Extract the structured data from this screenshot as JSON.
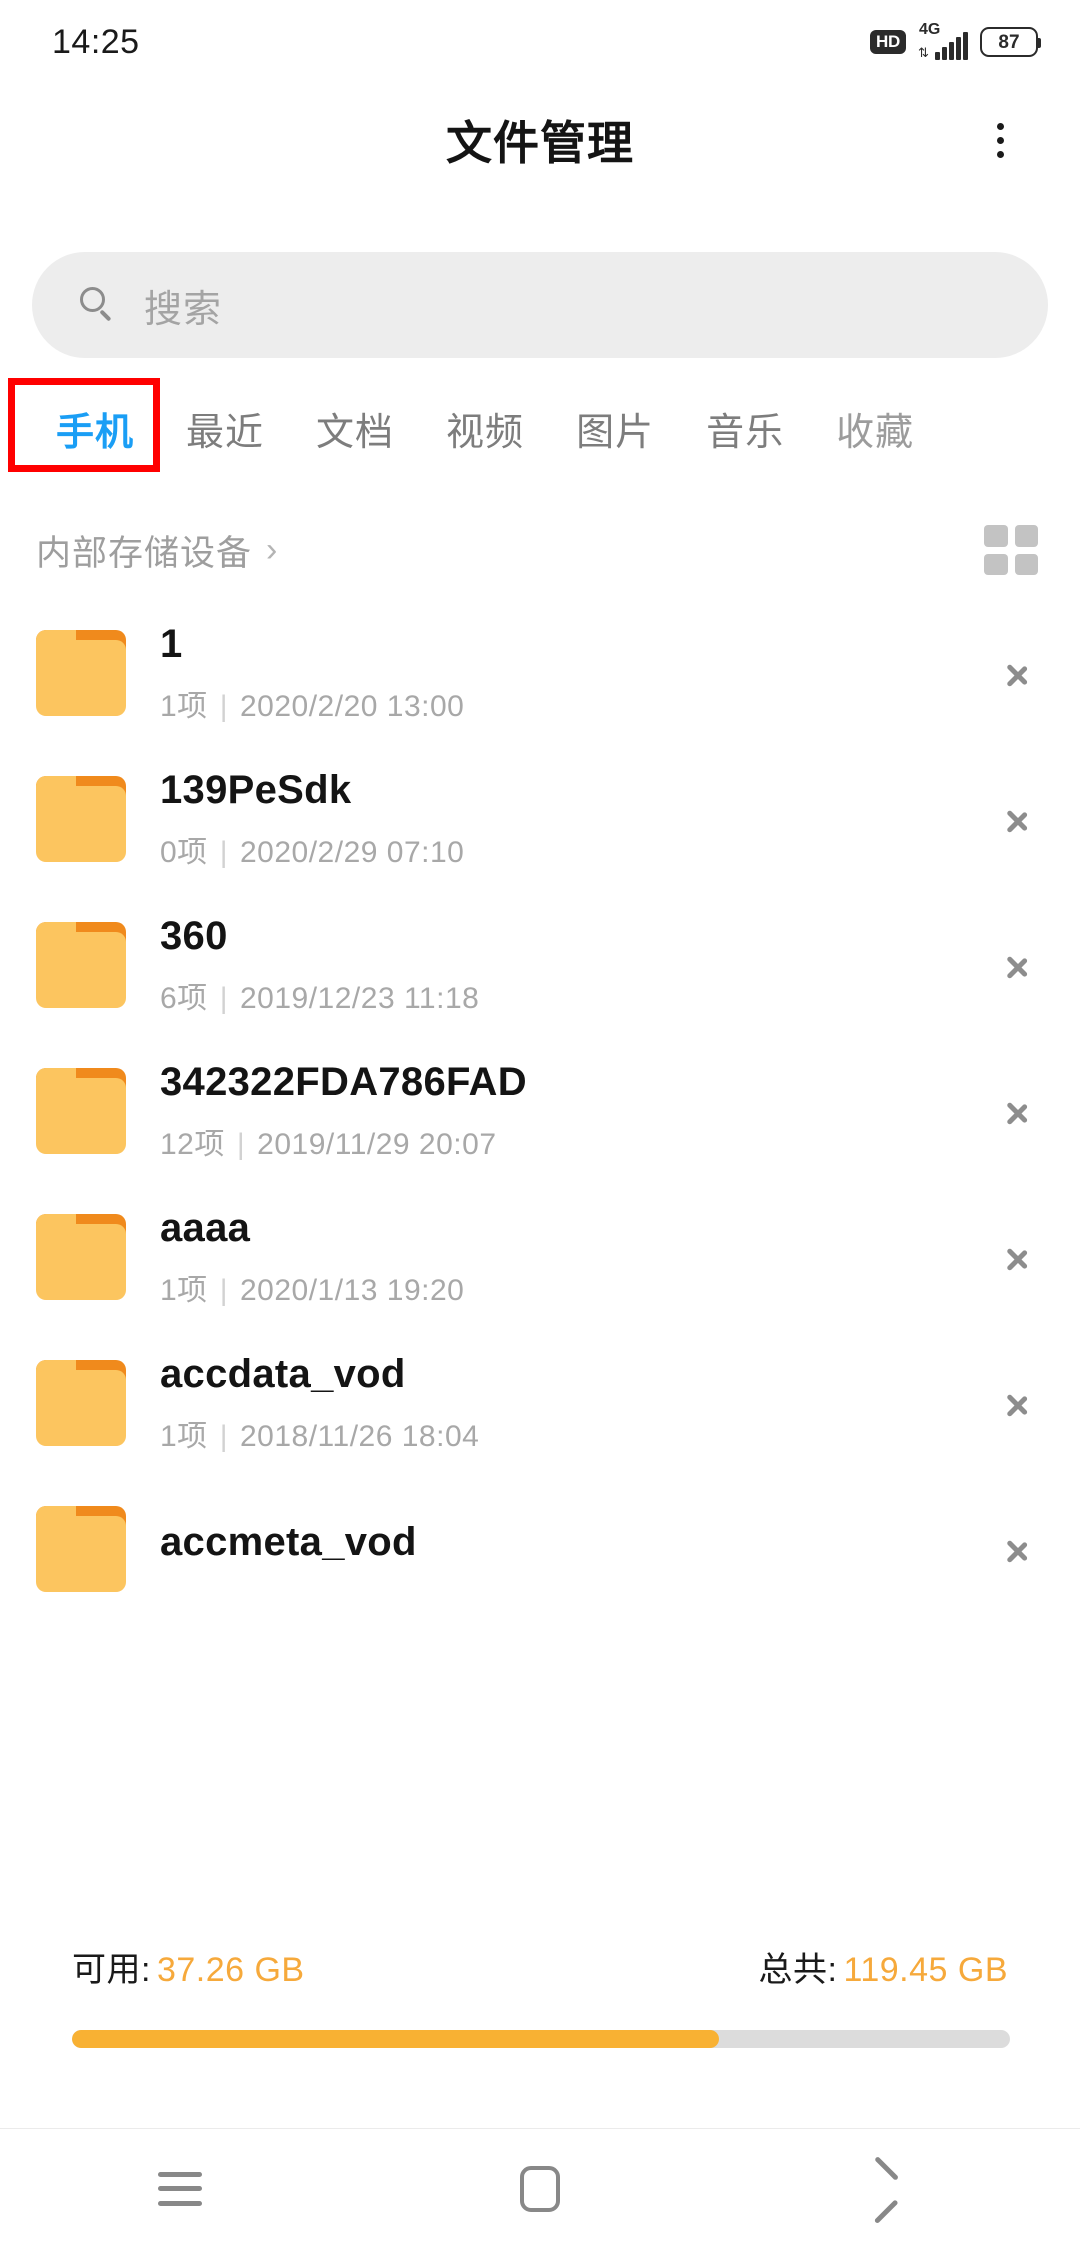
{
  "status_bar": {
    "time": "14:25",
    "hd_badge": "HD",
    "network": "4G",
    "battery_level": "87"
  },
  "app_bar": {
    "title": "文件管理",
    "overflow_menu_name": "more-options"
  },
  "search": {
    "placeholder": "搜索",
    "value": ""
  },
  "tabs": {
    "active_index": 0,
    "items": [
      {
        "label": "手机"
      },
      {
        "label": "最近"
      },
      {
        "label": "文档"
      },
      {
        "label": "视频"
      },
      {
        "label": "图片"
      },
      {
        "label": "音乐"
      },
      {
        "label": "收藏"
      }
    ],
    "highlight_color": "#ff0000",
    "active_color": "#1a9ef5"
  },
  "breadcrumb": {
    "path": "内部存储设备",
    "separator": "›",
    "view_toggle_name": "grid-view"
  },
  "file_list": [
    {
      "name": "1",
      "count": "1项",
      "date": "2020/2/20 13:00"
    },
    {
      "name": "139PeSdk",
      "count": "0项",
      "date": "2020/2/29 07:10"
    },
    {
      "name": "360",
      "count": "6项",
      "date": "2019/12/23 11:18"
    },
    {
      "name": "342322FDA786FAD",
      "count": "12项",
      "date": "2019/11/29 20:07"
    },
    {
      "name": "aaaa",
      "count": "1项",
      "date": "2020/1/13 19:20"
    },
    {
      "name": "accdata_vod",
      "count": "1项",
      "date": "2018/11/26 18:04"
    },
    {
      "name": "accmeta_vod",
      "count": "",
      "date": ""
    }
  ],
  "storage": {
    "available_label": "可用:",
    "available_value": "37.26 GB",
    "total_label": "总共:",
    "total_value": "119.45 GB",
    "used_percent": 69,
    "accent_color": "#f6a93b"
  },
  "nav_bar": {
    "recents": "recents-button",
    "home": "home-button",
    "back": "back-button"
  }
}
